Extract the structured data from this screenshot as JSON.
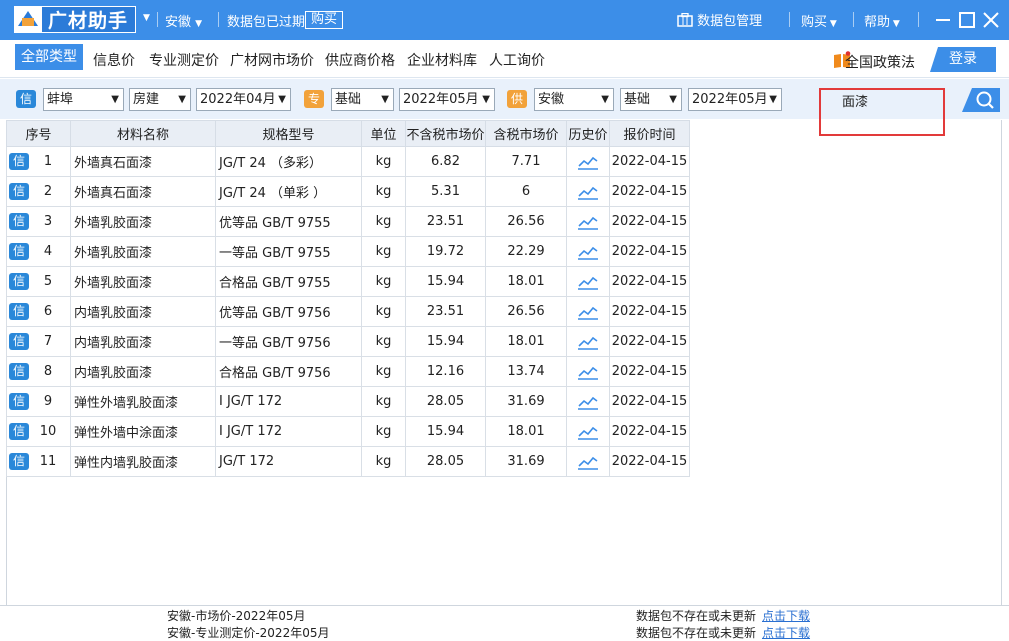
{
  "titlebar": {
    "app_name": "广材助手",
    "region": "安徽",
    "package_status": "数据包已过期",
    "buy_label": "购买",
    "package_manage": "数据包管理",
    "menu_buy": "购买",
    "menu_help": "帮助"
  },
  "nav": {
    "items": [
      "全部类型",
      "信息价",
      "专业测定价",
      "广材网市场价",
      "供应商价格",
      "企业材料库",
      "人工询价"
    ],
    "policy": "全国政策法",
    "login": "登录"
  },
  "filters": {
    "info_badge": "信",
    "info_city": "蚌埠",
    "info_type": "房建",
    "info_month": "2022年04月",
    "pro_badge": "专",
    "pro_type": "基础",
    "pro_month": "2022年05月",
    "supply_badge": "供",
    "supply_region": "安徽",
    "supply_type": "基础",
    "supply_month": "2022年05月",
    "search_value": "面漆"
  },
  "table": {
    "headers": [
      "序号",
      "材料名称",
      "规格型号",
      "单位",
      "不含税市场价",
      "含税市场价",
      "历史价",
      "报价时间"
    ],
    "badge": "信",
    "rows": [
      {
        "no": "1",
        "name": "外墙真石面漆",
        "spec": "JG/T 24 （多彩）",
        "unit": "kg",
        "price_ex": "6.82",
        "price_inc": "7.71",
        "date": "2022-04-15"
      },
      {
        "no": "2",
        "name": "外墙真石面漆",
        "spec": "JG/T 24 （单彩 ）",
        "unit": "kg",
        "price_ex": "5.31",
        "price_inc": "6",
        "date": "2022-04-15"
      },
      {
        "no": "3",
        "name": "外墙乳胶面漆",
        "spec": "优等品  GB/T 9755",
        "unit": "kg",
        "price_ex": "23.51",
        "price_inc": "26.56",
        "date": "2022-04-15"
      },
      {
        "no": "4",
        "name": "外墙乳胶面漆",
        "spec": "一等品  GB/T 9755",
        "unit": "kg",
        "price_ex": "19.72",
        "price_inc": "22.29",
        "date": "2022-04-15"
      },
      {
        "no": "5",
        "name": "外墙乳胶面漆",
        "spec": "合格品  GB/T 9755",
        "unit": "kg",
        "price_ex": "15.94",
        "price_inc": "18.01",
        "date": "2022-04-15"
      },
      {
        "no": "6",
        "name": "内墙乳胶面漆",
        "spec": "优等品  GB/T 9756",
        "unit": "kg",
        "price_ex": "23.51",
        "price_inc": "26.56",
        "date": "2022-04-15"
      },
      {
        "no": "7",
        "name": "内墙乳胶面漆",
        "spec": "一等品  GB/T 9756",
        "unit": "kg",
        "price_ex": "15.94",
        "price_inc": "18.01",
        "date": "2022-04-15"
      },
      {
        "no": "8",
        "name": "内墙乳胶面漆",
        "spec": "合格品  GB/T 9756",
        "unit": "kg",
        "price_ex": "12.16",
        "price_inc": "13.74",
        "date": "2022-04-15"
      },
      {
        "no": "9",
        "name": "弹性外墙乳胶面漆",
        "spec": " Ⅰ  JG/T 172",
        "unit": "kg",
        "price_ex": "28.05",
        "price_inc": "31.69",
        "date": "2022-04-15"
      },
      {
        "no": "10",
        "name": "弹性外墙中涂面漆",
        "spec": " Ⅰ  JG/T 172",
        "unit": "kg",
        "price_ex": "15.94",
        "price_inc": "18.01",
        "date": "2022-04-15"
      },
      {
        "no": "11",
        "name": "弹性内墙乳胶面漆",
        "spec": "JG/T 172",
        "unit": "kg",
        "price_ex": "28.05",
        "price_inc": "31.69",
        "date": "2022-04-15"
      }
    ]
  },
  "footer": {
    "line1_left": "安徽-市场价-2022年05月",
    "line2_left": "安徽-专业测定价-2022年05月",
    "line1_right": "数据包不存在或未更新",
    "line2_right": "数据包不存在或未更新",
    "download": "点击下载"
  },
  "colors": {
    "primary": "#3c8ee8",
    "badge_info": "#2a88d9",
    "badge_pro": "#f2a23a",
    "highlight": "#e23a3a"
  }
}
